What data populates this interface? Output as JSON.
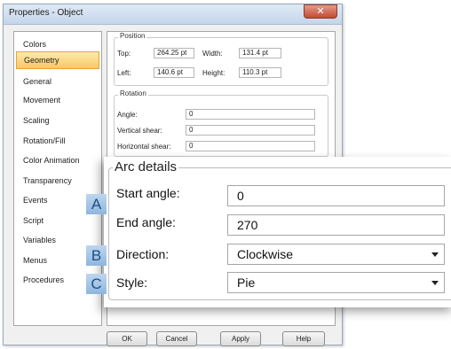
{
  "window": {
    "title": "Properties - Object",
    "close_glyph": "✕"
  },
  "nav": {
    "items": [
      {
        "label": "Colors",
        "selected": false
      },
      {
        "label": "Geometry",
        "selected": true
      },
      {
        "label": "General",
        "selected": false
      },
      {
        "label": "Movement",
        "selected": false
      },
      {
        "label": "Scaling",
        "selected": false
      },
      {
        "label": "Rotation/Fill",
        "selected": false
      },
      {
        "label": "Color Animation",
        "selected": false
      },
      {
        "label": "Transparency",
        "selected": false
      },
      {
        "label": "Events",
        "selected": false
      },
      {
        "label": "Script",
        "selected": false
      },
      {
        "label": "Variables",
        "selected": false
      },
      {
        "label": "Menus",
        "selected": false
      },
      {
        "label": "Procedures",
        "selected": false
      }
    ]
  },
  "position": {
    "legend": "Position",
    "top_label": "Top:",
    "top_value": "264.25 pt",
    "left_label": "Left:",
    "left_value": "140.6 pt",
    "width_label": "Width:",
    "width_value": "131.4 pt",
    "height_label": "Height:",
    "height_value": "110.3 pt"
  },
  "rotation": {
    "legend": "Rotation",
    "angle_label": "Angle:",
    "angle_value": "0",
    "vshear_label": "Vertical shear:",
    "vshear_value": "0",
    "hshear_label": "Horizontal shear:",
    "hshear_value": "0"
  },
  "arc": {
    "legend": "Arc details",
    "start_label": "Start angle:",
    "start_value": "0",
    "end_label": "End angle:",
    "end_value": "270",
    "direction_label": "Direction:",
    "direction_value": "Clockwise",
    "style_label": "Style:",
    "style_value": "Pie"
  },
  "callouts": {
    "a": "A",
    "b": "B",
    "c": "C"
  },
  "buttons": {
    "ok": "OK",
    "cancel": "Cancel",
    "apply": "Apply",
    "help": "Help"
  },
  "colors": {
    "selected_nav_bg": "#f7c961",
    "callout_bg": "#9dc0e4",
    "callout_text": "#1d4f86",
    "close_button": "#c44a33"
  }
}
